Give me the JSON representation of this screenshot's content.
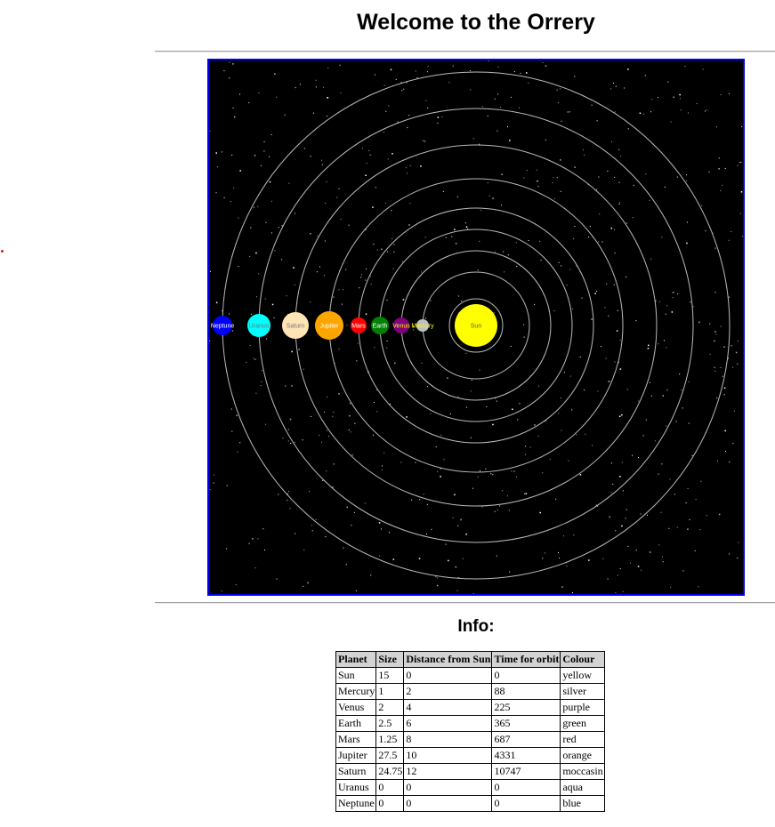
{
  "page": {
    "title": "Welcome to the Orrery"
  },
  "orrery": {
    "background": "#000000",
    "border_color": "#0000ee",
    "orbit_color": "#bbbbbb",
    "bodies": [
      {
        "name": "Sun",
        "fill": "#ffff00",
        "text_color": "#555555"
      },
      {
        "name": "Mercury",
        "fill": "#c0c0c0",
        "text_color": "#ffff00"
      },
      {
        "name": "Venus",
        "fill": "#800080",
        "text_color": "#ffff00"
      },
      {
        "name": "Earth",
        "fill": "#008000",
        "text_color": "#ffffff"
      },
      {
        "name": "Mars",
        "fill": "#ff0000",
        "text_color": "#ffffff"
      },
      {
        "name": "Jupiter",
        "fill": "#ffa500",
        "text_color": "#ffffff"
      },
      {
        "name": "Saturn",
        "fill": "#ffe4b5",
        "text_color": "#777777"
      },
      {
        "name": "Uranus",
        "fill": "#00ffff",
        "text_color": "#777777"
      },
      {
        "name": "Neptune",
        "fill": "#0000ff",
        "text_color": "#ffffff"
      }
    ]
  },
  "info": {
    "heading": "Info:",
    "columns": [
      "Planet",
      "Size",
      "Distance from Sun",
      "Time for orbit",
      "Colour"
    ],
    "rows": [
      [
        "Sun",
        "15",
        "0",
        "0",
        "yellow"
      ],
      [
        "Mercury",
        "1",
        "2",
        "88",
        "silver"
      ],
      [
        "Venus",
        "2",
        "4",
        "225",
        "purple"
      ],
      [
        "Earth",
        "2.5",
        "6",
        "365",
        "green"
      ],
      [
        "Mars",
        "1.25",
        "8",
        "687",
        "red"
      ],
      [
        "Jupiter",
        "27.5",
        "10",
        "4331",
        "orange"
      ],
      [
        "Saturn",
        "24.75",
        "12",
        "10747",
        "moccasin"
      ],
      [
        "Uranus",
        "0",
        "0",
        "0",
        "aqua"
      ],
      [
        "Neptune",
        "0",
        "0",
        "0",
        "blue"
      ]
    ]
  }
}
